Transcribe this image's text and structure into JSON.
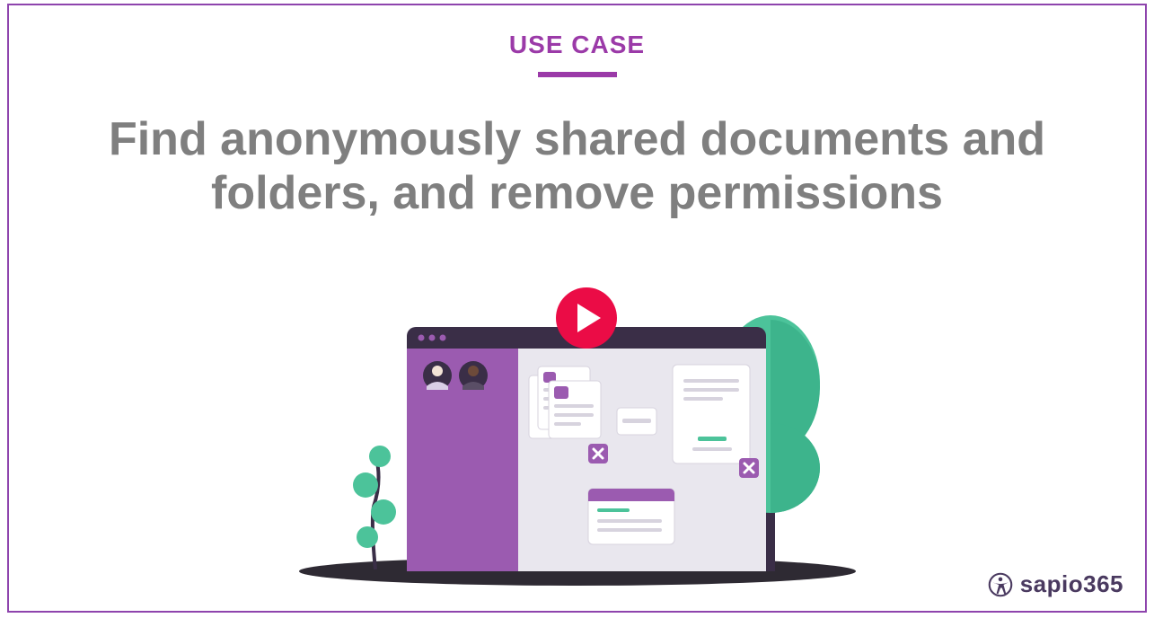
{
  "eyebrow": "USE CASE",
  "headline": "Find anonymously shared documents and folders, and remove permissions",
  "brand": "sapio365",
  "colors": {
    "accent": "#9b3aa8",
    "play": "#eb0c46",
    "tree": "#4cc39a",
    "darkbar": "#3a2e47",
    "sidebar": "#9b5bb0",
    "panel": "#e9e7ee"
  },
  "icons": {
    "play": "play-icon",
    "brand": "accessibility-icon"
  }
}
